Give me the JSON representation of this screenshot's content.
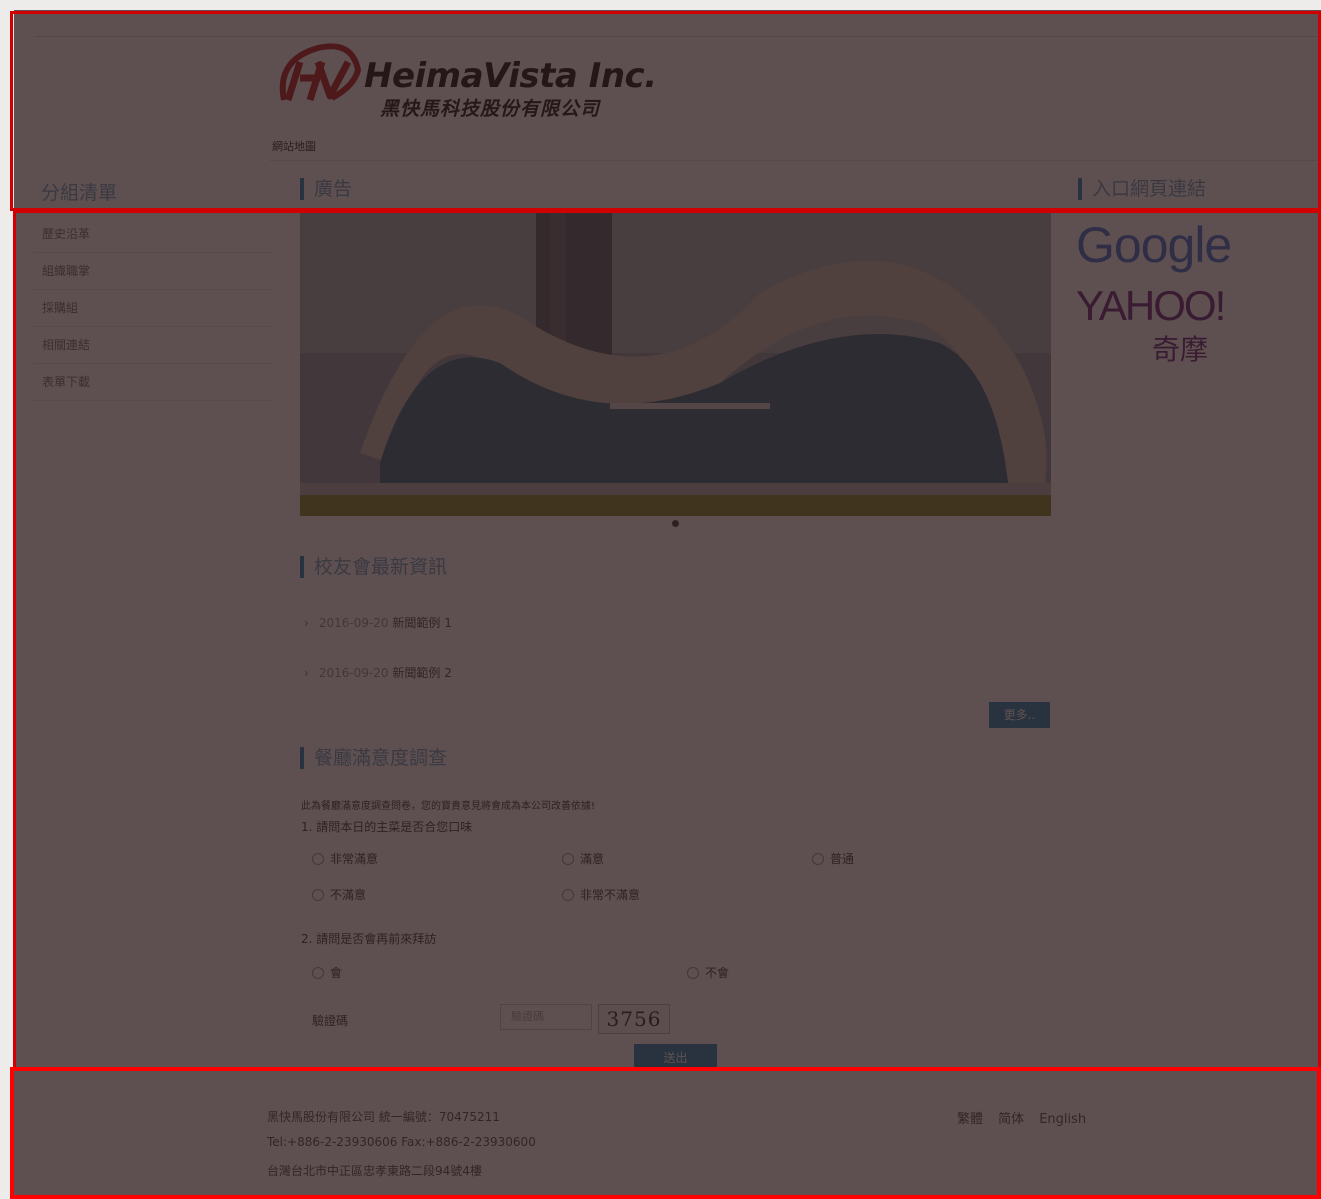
{
  "header": {
    "logo_main": "HeimaVista Inc.",
    "logo_sub": "黑快馬科技股份有限公司",
    "sitemap": "網站地圖"
  },
  "sidebar": {
    "title": "分組清單",
    "items": [
      "歷史沿革",
      "組織職掌",
      "採購組",
      "相關連結",
      "表單下載"
    ]
  },
  "ads": {
    "title": "廣告"
  },
  "portal": {
    "title": "入口網頁連結",
    "links": [
      "Google",
      "YAHOO!",
      "奇摩"
    ]
  },
  "news": {
    "title": "校友會最新資訊",
    "items": [
      {
        "date": "2016-09-20",
        "title": "新聞範例 1"
      },
      {
        "date": "2016-09-20",
        "title": "新聞範例 2"
      }
    ],
    "more": "更多.."
  },
  "survey": {
    "title": "餐廳滿意度調查",
    "intro": "此為餐廳滿意度調查問卷，您的寶貴意見將會成為本公司改善依據!",
    "q1": "1. 請問本日的主菜是否合您口味",
    "q1_options": [
      "非常滿意",
      "滿意",
      "普通",
      "不滿意",
      "非常不滿意"
    ],
    "q2": "2. 請問是否會再前來拜訪",
    "q2_options": [
      "會",
      "不會"
    ],
    "captcha_label": "驗證碼",
    "captcha_placeholder": "驗證碼",
    "captcha_code": "3756",
    "submit": "送出"
  },
  "footer": {
    "company": "黑快馬股份有限公司 統一編號：70475211",
    "contact": "Tel:+886-2-23930606 Fax:+886-2-23930600",
    "address": "台灣台北市中正區忠孝東路二段94號4樓",
    "languages": [
      "繁體",
      "简体",
      "English"
    ]
  },
  "colors": {
    "accent": "#2e8bc0",
    "highlight_border": "#d00000",
    "overlay": "rgba(40,22,22,0.75)"
  }
}
